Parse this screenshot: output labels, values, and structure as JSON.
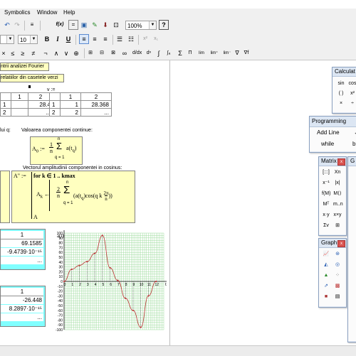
{
  "menu": [
    "Symbolics",
    "Window",
    "Help"
  ],
  "toolbar": {
    "font_size": "10",
    "zoom": "100%",
    "bold": "B",
    "italic": "I",
    "underline": "U",
    "help": "?",
    "fx": "f(x)",
    "eq": "="
  },
  "math_toolbar": [
    "×",
    "≤",
    "≥",
    "≠",
    "¬",
    "∧",
    "∨",
    "⊕",
    "∞",
    "∫",
    "Σ",
    "lim"
  ],
  "sheet": {
    "title_fragment": "ntrii analizei Fourier",
    "subtitle_fragment": "relatiilor din casetele verzi",
    "v_label": "v :=",
    "matrix_left": {
      "header": [
        "",
        "1",
        "2"
      ],
      "rows": [
        [
          "1",
          "",
          "28.4"
        ],
        [
          "2",
          "",
          "..."
        ]
      ]
    },
    "matrix_right": {
      "header": [
        "",
        "1",
        "2"
      ],
      "rows": [
        [
          "1",
          "1",
          "28.368"
        ],
        [
          "2",
          "2",
          "..."
        ]
      ]
    },
    "q_label": "lui q:",
    "continuous_label": "Valoarea componentei continue:",
    "a0_formula": "A0 := (1/n) Σ a(tq)",
    "sum_lower": "q = 1",
    "sum_upper": "n",
    "cosine_label": "Vectorul amplitudinii componentei in cosinus:",
    "program_assign": "A\" :=",
    "program_for": "for k ∈ 1 .. kmax",
    "program_body": "Ak ← (2/n) Σ a(tq) cos(q k 2π/n)",
    "program_return": "A",
    "vector1": {
      "header": "1",
      "values": [
        "69.1585",
        "-9.4739·10⁻¹⁵",
        "..."
      ]
    },
    "vector2": {
      "header": "1",
      "values": [
        "-26.448",
        "8.2897·10⁻¹⁵",
        "..."
      ]
    },
    "plot_ylabel": "a(t)",
    "plot_xlabel": "t"
  },
  "chart_data": {
    "type": "line",
    "ylabel": "a(t)",
    "xlabel": "t",
    "x": [
      0,
      1,
      2,
      3,
      4,
      5,
      6,
      7,
      8,
      9,
      10,
      11,
      12
    ],
    "y": [
      0,
      25,
      33,
      41,
      58,
      95,
      28,
      2,
      -35,
      -60,
      -95,
      -30,
      0
    ],
    "ylim": [
      -100,
      100
    ],
    "xlim": [
      0,
      13
    ],
    "yticks": [
      "100",
      "90",
      "80",
      "70",
      "60",
      "50",
      "40",
      "30",
      "20",
      "10",
      "0",
      "-10",
      "-20",
      "-30",
      "-40",
      "-50",
      "-60",
      "-70",
      "-80",
      "-90",
      "-100"
    ],
    "xticks": [
      "0",
      "1",
      "2",
      "3",
      "4",
      "5",
      "6",
      "7",
      "8",
      "9",
      "10",
      "11",
      "12"
    ],
    "grid": true
  },
  "calculator": {
    "title": "Calculat",
    "row1": [
      "sin",
      "cos"
    ],
    "row2": [
      "( )",
      "x²"
    ],
    "row3": [
      "×",
      "÷"
    ]
  },
  "programming": {
    "title": "Programming",
    "items": [
      "Add Line",
      "←",
      "while",
      "br"
    ]
  },
  "matrix_palette": {
    "title": "Matrix",
    "cells": [
      "[:::]",
      "Xn",
      "x⁻¹",
      "|x|",
      "f(M)",
      "M⟨⟩",
      "Mᵀ",
      "m..n",
      "x·y",
      "x×y",
      "Σv",
      "⊞"
    ]
  },
  "graph_palette": {
    "title": "Graph"
  },
  "g_palette": {
    "title": "G"
  }
}
